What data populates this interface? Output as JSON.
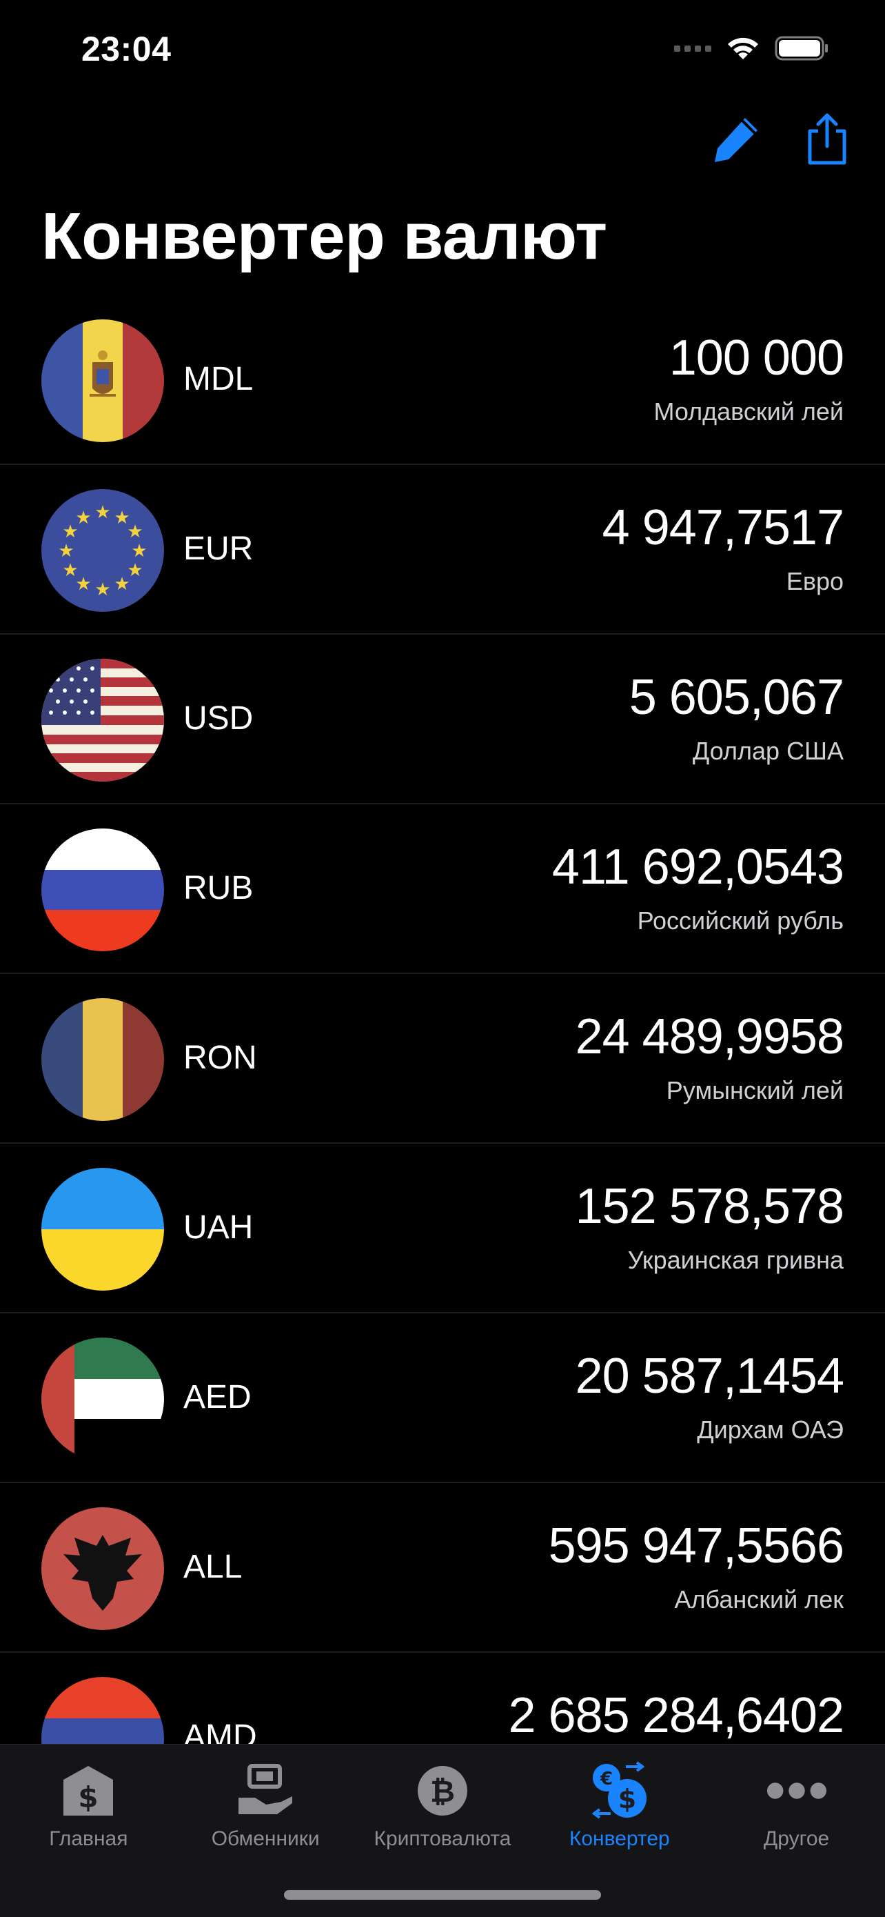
{
  "status": {
    "time": "23:04"
  },
  "header": {
    "title": "Конвертер валют"
  },
  "currencies": [
    {
      "code": "MDL",
      "amount": "100 000",
      "name": "Молдавский лей"
    },
    {
      "code": "EUR",
      "amount": "4 947,7517",
      "name": "Евро"
    },
    {
      "code": "USD",
      "amount": "5 605,067",
      "name": "Доллар США"
    },
    {
      "code": "RUB",
      "amount": "411 692,0543",
      "name": "Российский рубль"
    },
    {
      "code": "RON",
      "amount": "24 489,9958",
      "name": "Румынский лей"
    },
    {
      "code": "UAH",
      "amount": "152 578,578",
      "name": "Украинская гривна"
    },
    {
      "code": "AED",
      "amount": "20 587,1454",
      "name": "Дирхам ОАЭ"
    },
    {
      "code": "ALL",
      "amount": "595 947,5566",
      "name": "Албанский лек"
    },
    {
      "code": "AMD",
      "amount": "2 685 284,6402",
      "name": ""
    }
  ],
  "tabbar": {
    "items": [
      {
        "label": "Главная",
        "icon": "bank-dollar-icon",
        "active": false
      },
      {
        "label": "Обменники",
        "icon": "exchange-hand-icon",
        "active": false
      },
      {
        "label": "Криптовалюта",
        "icon": "bitcoin-icon",
        "active": false
      },
      {
        "label": "Конвертер",
        "icon": "currency-convert-icon",
        "active": true
      },
      {
        "label": "Другое",
        "icon": "more-dots-icon",
        "active": false
      }
    ]
  },
  "colors": {
    "accent": "#1a84ff",
    "background": "#000000",
    "inactive": "#8e8e93",
    "separator": "#1c1c1e"
  }
}
